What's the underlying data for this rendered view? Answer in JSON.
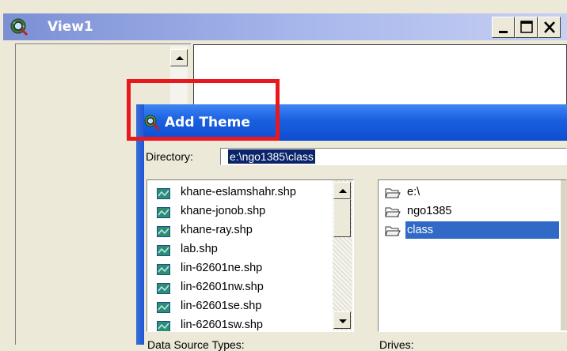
{
  "view_window": {
    "title": "View1",
    "buttons": {
      "minimize": "minimize",
      "maximize": "maximize",
      "close": "close"
    }
  },
  "dialog": {
    "title": "Add Theme",
    "directory_label": "Directory:",
    "directory_value": "e:\\ngo1385\\class",
    "files": [
      "khane-eslamshahr.shp",
      "khane-jonob.shp",
      "khane-ray.shp",
      "lab.shp",
      "lin-62601ne.shp",
      "lin-62601nw.shp",
      "lin-62601se.shp",
      "lin-62601sw.shp"
    ],
    "directories": [
      {
        "name": "e:\\",
        "selected": false
      },
      {
        "name": "ngo1385",
        "selected": false
      },
      {
        "name": "class",
        "selected": true
      }
    ],
    "data_source_types_label": "Data Source Types:",
    "drives_label": "Drives:"
  },
  "colors": {
    "highlight": "#e8191e",
    "dialog_title_bar": "#1a5fe0",
    "selection": "#3169c6"
  }
}
